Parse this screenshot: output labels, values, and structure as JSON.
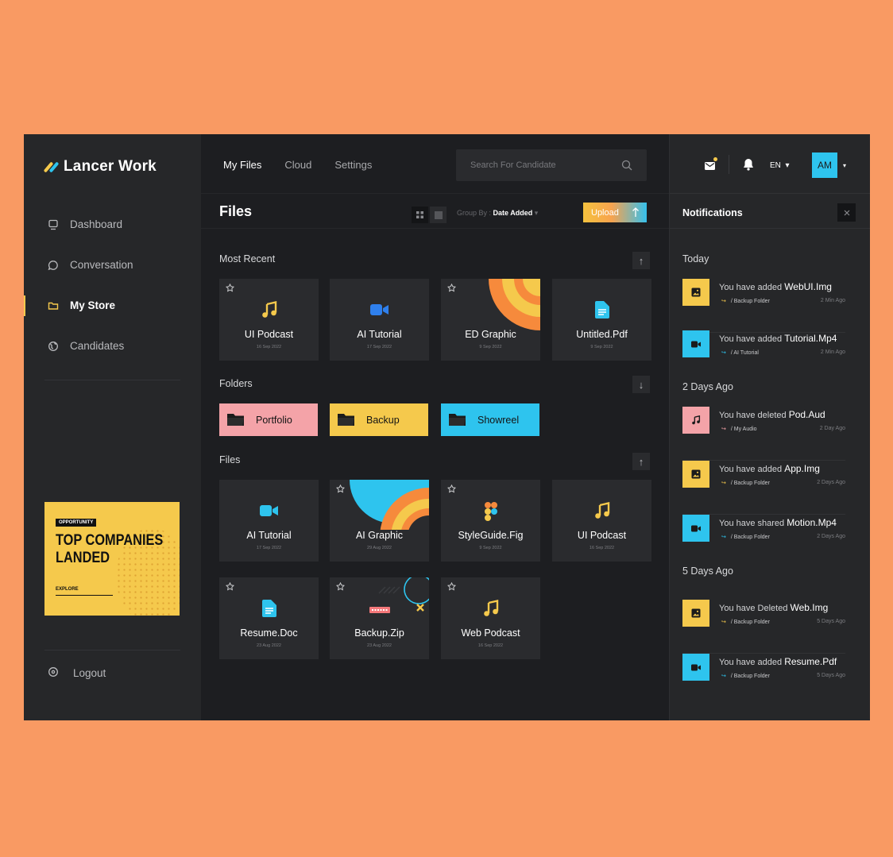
{
  "colors": {
    "background": "#F99A63",
    "app": "#1D1E21",
    "panel": "#262729",
    "yellow": "#F5C94C",
    "blue": "#2EC4EE",
    "pink": "#F4A3A8",
    "orange": "#F68A3C"
  },
  "brand": {
    "name": "Lancer Work"
  },
  "sidebar": {
    "items": [
      {
        "label": "Dashboard",
        "icon": "monitor-icon",
        "active": false
      },
      {
        "label": "Conversation",
        "icon": "chat-icon",
        "active": false
      },
      {
        "label": "My Store",
        "icon": "folder-icon",
        "active": true
      },
      {
        "label": "Candidates",
        "icon": "globe-icon",
        "active": false
      }
    ],
    "promo": {
      "badge": "OPPORTUNITY",
      "title_line1": "TOP COMPANIES",
      "title_line2": "LANDED",
      "link": "EXPLORE"
    },
    "logout": "Logout"
  },
  "header": {
    "tabs": [
      {
        "label": "My Files",
        "active": true
      },
      {
        "label": "Cloud",
        "active": false
      },
      {
        "label": "Settings",
        "active": false
      }
    ],
    "search": {
      "placeholder": "Search For Candidate"
    }
  },
  "files_panel": {
    "title": "Files",
    "group_by_label": "Group By :",
    "group_by_value": "Date Added",
    "upload_label": "Upload",
    "most_recent": {
      "label": "Most Recent",
      "items": [
        {
          "name": "UI Podcast",
          "date": "16 Sep 2022",
          "icon": "music-icon"
        },
        {
          "name": "AI Tutorial",
          "date": "17 Sep 2022",
          "icon": "video-icon"
        },
        {
          "name": "ED Graphic",
          "date": "9 Sep 2022",
          "icon": "graphic-icon"
        },
        {
          "name": "Untitled.Pdf",
          "date": "9 Sep 2022",
          "icon": "document-icon"
        }
      ]
    },
    "folders": {
      "label": "Folders",
      "items": [
        {
          "name": "Portfolio",
          "color": "#F4A3A8"
        },
        {
          "name": "Backup",
          "color": "#F5C94C"
        },
        {
          "name": "Showreel",
          "color": "#2EC4EE"
        }
      ]
    },
    "files": {
      "label": "Files",
      "items": [
        {
          "name": "AI Tutorial",
          "date": "17 Sep 2022",
          "icon": "video-icon"
        },
        {
          "name": "AI Graphic",
          "date": "29 Aug 2022",
          "icon": "graphic-icon"
        },
        {
          "name": "StyleGuide.Fig",
          "date": "9 Sep 2022",
          "icon": "figma-icon"
        },
        {
          "name": "UI Podcast",
          "date": "16 Sep 2022",
          "icon": "music-icon"
        },
        {
          "name": "Resume.Doc",
          "date": "23 Aug 2022",
          "icon": "document-icon"
        },
        {
          "name": "Backup.Zip",
          "date": "23 Aug 2022",
          "icon": "zip-icon"
        },
        {
          "name": "Web Podcast",
          "date": "16 Sep 2022",
          "icon": "music-icon"
        }
      ]
    }
  },
  "topbar_right": {
    "language": "EN",
    "avatar_initials": "AM"
  },
  "notifications": {
    "title": "Notifications",
    "groups": [
      {
        "label": "Today",
        "items": [
          {
            "text": "You have added",
            "file": "WebUI.Img",
            "path": "/ Backup Folder",
            "time": "2 Min Ago",
            "type": "image",
            "color": "#F5C94C"
          },
          {
            "text": "You have added",
            "file": "Tutorial.Mp4",
            "path": "/ AI Tutorial",
            "time": "2 Min Ago",
            "type": "video",
            "color": "#2EC4EE"
          }
        ]
      },
      {
        "label": "2 Days Ago",
        "items": [
          {
            "text": "You have deleted",
            "file": "Pod.Aud",
            "path": "/ My Audio",
            "time": "2 Day Ago",
            "type": "audio",
            "color": "#F4A3A8"
          },
          {
            "text": "You have added",
            "file": "App.Img",
            "path": "/ Backup Folder",
            "time": "2 Days Ago",
            "type": "image",
            "color": "#F5C94C"
          },
          {
            "text": "You have shared",
            "file": "Motion.Mp4",
            "path": "/ Backup Folder",
            "time": "2 Days Ago",
            "type": "video",
            "color": "#2EC4EE"
          }
        ]
      },
      {
        "label": "5 Days Ago",
        "items": [
          {
            "text": "You have Deleted",
            "file": "Web.Img",
            "path": "/ Backup Folder",
            "time": "5 Days Ago",
            "type": "image",
            "color": "#F5C94C"
          },
          {
            "text": "You have added",
            "file": "Resume.Pdf",
            "path": "/ Backup Folder",
            "time": "5 Days Ago",
            "type": "video",
            "color": "#2EC4EE"
          }
        ]
      }
    ]
  }
}
